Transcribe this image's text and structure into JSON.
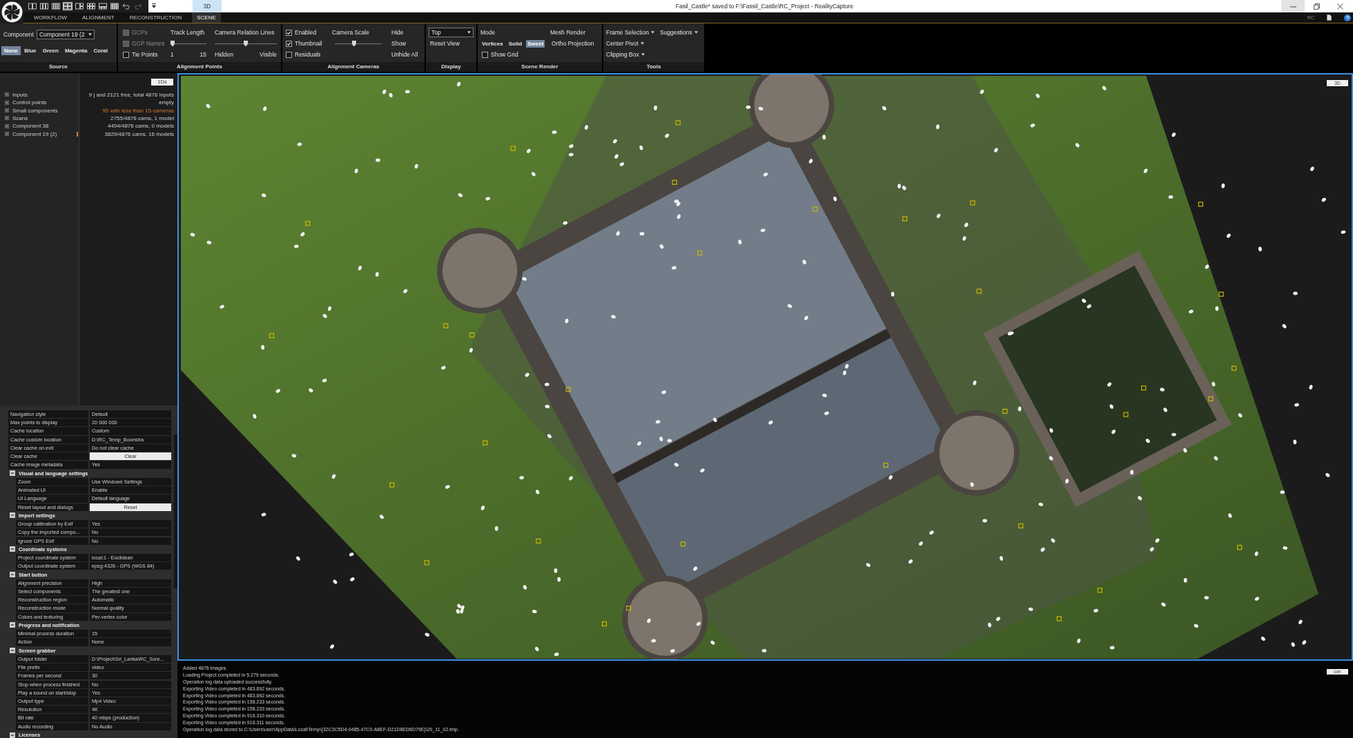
{
  "window": {
    "title": "Fasil_Castle* saved to F:\\Fassil_Castle\\RC_Project - RealityCapture",
    "controls": [
      {
        "kind": "minimize",
        "highlighted": true
      },
      {
        "kind": "restore",
        "highlighted": false
      },
      {
        "kind": "close",
        "highlighted": false
      }
    ]
  },
  "quick_access": {
    "tools": [
      {
        "kind": "layout-split-2",
        "selected": false,
        "disabled": false
      },
      {
        "kind": "layout-split-3",
        "selected": false,
        "disabled": false
      },
      {
        "kind": "layout-columns",
        "selected": false,
        "disabled": false
      },
      {
        "kind": "layout-split-4",
        "selected": true,
        "disabled": false
      },
      {
        "kind": "layout-main-left",
        "selected": false,
        "disabled": false
      },
      {
        "kind": "layout-six",
        "selected": false,
        "disabled": false
      },
      {
        "kind": "layout-main-top",
        "selected": false,
        "disabled": false
      },
      {
        "kind": "layout-grid",
        "selected": false,
        "disabled": false
      },
      {
        "kind": "undo",
        "selected": false,
        "disabled": false
      },
      {
        "kind": "redo",
        "selected": false,
        "disabled": true
      }
    ]
  },
  "view_tabs": [
    {
      "label": "3D",
      "selected": true
    }
  ],
  "tabs": [
    {
      "label": "WORKFLOW",
      "selected": false
    },
    {
      "label": "ALIGNMENT",
      "selected": false
    },
    {
      "label": "RECONSTRUCTION",
      "selected": false
    },
    {
      "label": "SCENE",
      "selected": true
    }
  ],
  "account": {
    "label": "RC"
  },
  "ribbon": {
    "source": {
      "title": "Source",
      "component_label": "Component",
      "component_value": "Component 19 (2",
      "options": [
        {
          "label": "None",
          "selected": true
        },
        {
          "label": "Blue",
          "selected": false
        },
        {
          "label": "Green",
          "selected": false
        },
        {
          "label": "Magenta",
          "selected": false
        },
        {
          "label": "Coral",
          "selected": false
        }
      ]
    },
    "alignment_points": {
      "title": "Alignment Points",
      "checkboxes": [
        {
          "label": "GCPs",
          "checked": false,
          "disabled": true
        },
        {
          "label": "GCP Names",
          "checked": false,
          "disabled": true
        },
        {
          "label": "Tie Points",
          "checked": false,
          "disabled": false
        }
      ],
      "sliders": [
        {
          "label": "Track Length",
          "level": 0,
          "min_label": "1",
          "max_label": "15"
        },
        {
          "label": "Camera Relation Lines",
          "level": 0.5,
          "min_label": "Hidden",
          "max_label": "Visible"
        }
      ]
    },
    "alignment_cameras": {
      "title": "Alignment Cameras",
      "checkboxes": [
        {
          "label": "Enabled",
          "checked": true,
          "disabled": false
        },
        {
          "label": "Thumbnail",
          "checked": true,
          "disabled": false
        },
        {
          "label": "Residuals",
          "checked": false,
          "disabled": false
        }
      ],
      "slider": {
        "label": "Camera Scale",
        "level": 0.4
      },
      "buttons": [
        "Hide",
        "Show",
        "Unhide All"
      ]
    },
    "display": {
      "title": "Display",
      "view_value": "Top",
      "buttons": [
        "Reset View"
      ]
    },
    "scene_render": {
      "title": "Scene Render",
      "mode_label": "Mode",
      "modes": [
        {
          "label": "Vertices",
          "selected": false
        },
        {
          "label": "Solid",
          "selected": false
        },
        {
          "label": "Sweet",
          "selected": true
        }
      ],
      "mesh_render_label": "Mesh Render",
      "mesh_buttons": [
        "Ortho Projection"
      ],
      "show_grid": {
        "label": "Show Grid",
        "checked": false
      }
    },
    "tools": {
      "title": "Tools",
      "menu_rows": [
        [
          "Frame Selection",
          "Suggestions"
        ],
        [
          "Center Pivot"
        ],
        [
          "Clipping Box"
        ]
      ]
    }
  },
  "project_tree": {
    "button": "1Ds",
    "items": [
      {
        "label": "Inputs",
        "value": "9 j and 2121 free, total 4876 inputs",
        "expanded": false,
        "warning": false,
        "selected": false
      },
      {
        "label": "Control points",
        "value": "empty",
        "expanded": false,
        "warning": false,
        "selected": false
      },
      {
        "label": "Small components",
        "value": "95 with less than 15 cameras",
        "expanded": false,
        "warning": true,
        "selected": false
      },
      {
        "label": "Scans",
        "value": "2755/4876 cams, 1 model",
        "expanded": false,
        "warning": false,
        "selected": false
      },
      {
        "label": "Component 38",
        "value": "4494/4876 cams, 0 models",
        "expanded": false,
        "warning": false,
        "selected": false
      },
      {
        "label": "Component 19 (2)",
        "value": "3829/4876 cams, 16 models",
        "expanded": false,
        "warning": false,
        "selected": true
      }
    ]
  },
  "settings": {
    "rows": [
      {
        "kind": "value",
        "name": "Navigation style",
        "value": "Default"
      },
      {
        "kind": "value",
        "name": "Max points to display",
        "value": "20 000 000"
      },
      {
        "kind": "value",
        "name": "Cache location",
        "value": "Custom"
      },
      {
        "kind": "value",
        "name": "Cache custom location",
        "value": "D:\\RC_Temp_Boonstra"
      },
      {
        "kind": "value",
        "name": "Clear cache on exit",
        "value": "Do not clear cache"
      },
      {
        "kind": "button",
        "name": "Clear cache",
        "button": "Clear"
      },
      {
        "kind": "value",
        "name": "Cache image metadata",
        "value": "Yes"
      },
      {
        "kind": "section",
        "title": "Visual and language settings",
        "expanded": true,
        "children": [
          {
            "kind": "value",
            "name": "Zoom",
            "value": "Use Windows Settings"
          },
          {
            "kind": "value",
            "name": "Animated UI",
            "value": "Enable"
          },
          {
            "kind": "value",
            "name": "UI Language",
            "value": "Default language"
          },
          {
            "kind": "button",
            "name": "Reset layout and dialogs",
            "button": "Reset"
          }
        ]
      },
      {
        "kind": "section",
        "title": "Import settings",
        "expanded": true,
        "children": [
          {
            "kind": "value",
            "name": "Group calibration by Exif",
            "value": "Yes"
          },
          {
            "kind": "value",
            "name": "Copy the imported compo...",
            "value": "No"
          },
          {
            "kind": "value",
            "name": "Ignore GPS Exif",
            "value": "No"
          }
        ]
      },
      {
        "kind": "section",
        "title": "Coordinate systems",
        "expanded": true,
        "children": [
          {
            "kind": "value",
            "name": "Project coordinate system",
            "value": "local:1 - Euclidean"
          },
          {
            "kind": "value",
            "name": "Output coordinate system",
            "value": "epsg:4326 - GPS (WGS 84)"
          }
        ]
      },
      {
        "kind": "section",
        "title": "Start button",
        "expanded": true,
        "children": [
          {
            "kind": "value",
            "name": "Alignment precision",
            "value": "High"
          },
          {
            "kind": "value",
            "name": "Select components",
            "value": "The greatest one"
          },
          {
            "kind": "value",
            "name": "Reconstruction region",
            "value": "Automatic"
          },
          {
            "kind": "value",
            "name": "Reconstruction mode",
            "value": "Normal quality"
          },
          {
            "kind": "value",
            "name": "Colors and texturing",
            "value": "Per-vertex color"
          }
        ]
      },
      {
        "kind": "section",
        "title": "Progress and notification",
        "expanded": true,
        "children": [
          {
            "kind": "value",
            "name": "Minimal process duration",
            "value": "15"
          },
          {
            "kind": "value",
            "name": "Action",
            "value": "None"
          }
        ]
      },
      {
        "kind": "section",
        "title": "Screen grabber",
        "expanded": true,
        "children": [
          {
            "kind": "value",
            "name": "Output folder",
            "value": "D:\\Project\\Sri_Lanka\\RC_Scre..."
          },
          {
            "kind": "value",
            "name": "File prefix",
            "value": "video"
          },
          {
            "kind": "value",
            "name": "Frames per second",
            "value": "30"
          },
          {
            "kind": "value",
            "name": "Stop when process finished",
            "value": "No"
          },
          {
            "kind": "value",
            "name": "Play a sound on start/stop",
            "value": "Yes"
          },
          {
            "kind": "value",
            "name": "Output type",
            "value": "Mp4 Video"
          },
          {
            "kind": "value",
            "name": "Resolution",
            "value": "4K"
          },
          {
            "kind": "value",
            "name": "Bit rate",
            "value": "40 mbps (production)"
          },
          {
            "kind": "value",
            "name": "Audio recording",
            "value": "No Audio"
          }
        ]
      },
      {
        "kind": "section",
        "title": "Licenses",
        "expanded": true,
        "children": []
      }
    ]
  },
  "viewport": {
    "view_button": "3D"
  },
  "log": {
    "lines": [
      "Added 4876 images.",
      "Loading Project completed in 5.279 seconds.",
      "Operation log data uploaded successfully.",
      "Exporting Video completed in 483.892 seconds.",
      "Exporting Video completed in 483.892 seconds.",
      "Exporting Video completed in 158.233 seconds.",
      "Exporting Video completed in 158.233 seconds.",
      "Exporting Video completed in 916.310 seconds.",
      "Exporting Video completed in 916.311 seconds.",
      "Operation log data stored to C:\\Users\\user\\AppData\\Local\\Temp\\{32C3C5D4-0485-47C0-A8EF-D21D8ED6D79E}\\20_11_02.tmp."
    ],
    "button": "con"
  }
}
